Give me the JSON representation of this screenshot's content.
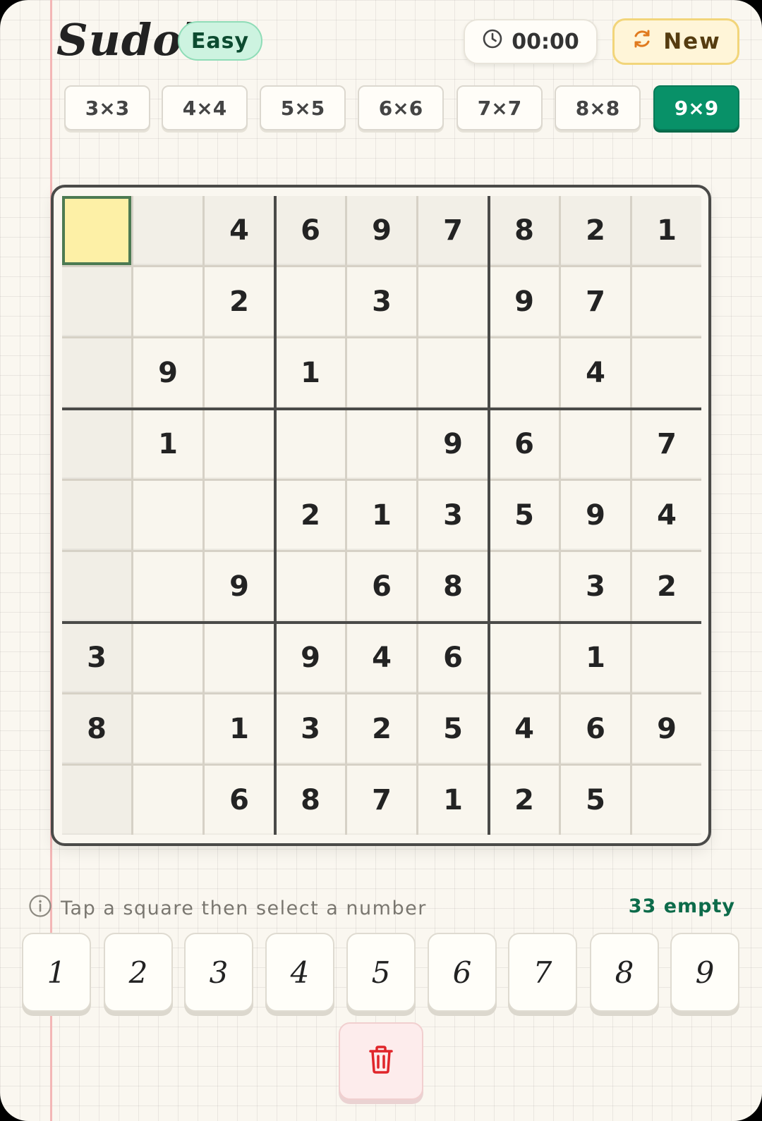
{
  "header": {
    "title": "Sudok",
    "level": "Easy",
    "timer": "00:00",
    "new_label": "New"
  },
  "sizes": [
    "3×3",
    "4×4",
    "5×5",
    "6×6",
    "7×7",
    "8×8",
    "9×9"
  ],
  "active_size": "9×9",
  "board": {
    "selected": [
      0,
      0
    ],
    "grid": [
      [
        "",
        "",
        "4",
        "6",
        "9",
        "7",
        "8",
        "2",
        "1"
      ],
      [
        "",
        "",
        "2",
        "",
        "3",
        "",
        "9",
        "7",
        ""
      ],
      [
        "",
        "9",
        "",
        "1",
        "",
        "",
        "",
        "4",
        ""
      ],
      [
        "",
        "1",
        "",
        "",
        "",
        "9",
        "6",
        "",
        "7"
      ],
      [
        "",
        "",
        "",
        "2",
        "1",
        "3",
        "5",
        "9",
        "4"
      ],
      [
        "",
        "",
        "9",
        "",
        "6",
        "8",
        "",
        "3",
        "2"
      ],
      [
        "3",
        "",
        "",
        "9",
        "4",
        "6",
        "",
        "1",
        ""
      ],
      [
        "8",
        "",
        "1",
        "3",
        "2",
        "5",
        "4",
        "6",
        "9"
      ],
      [
        "",
        "",
        "6",
        "8",
        "7",
        "1",
        "2",
        "5",
        ""
      ]
    ]
  },
  "hint": "Tap a square then select a number",
  "empty_count": "33 empty",
  "numpad": [
    "1",
    "2",
    "3",
    "4",
    "5",
    "6",
    "7",
    "8",
    "9"
  ],
  "icons": {
    "timer": "clock-icon",
    "new": "refresh-icon",
    "hint": "info-icon",
    "delete": "trash-icon"
  },
  "colors": {
    "accent": "#089168",
    "selected_cell": "#fdf0a6",
    "delete": "#e0252a"
  }
}
